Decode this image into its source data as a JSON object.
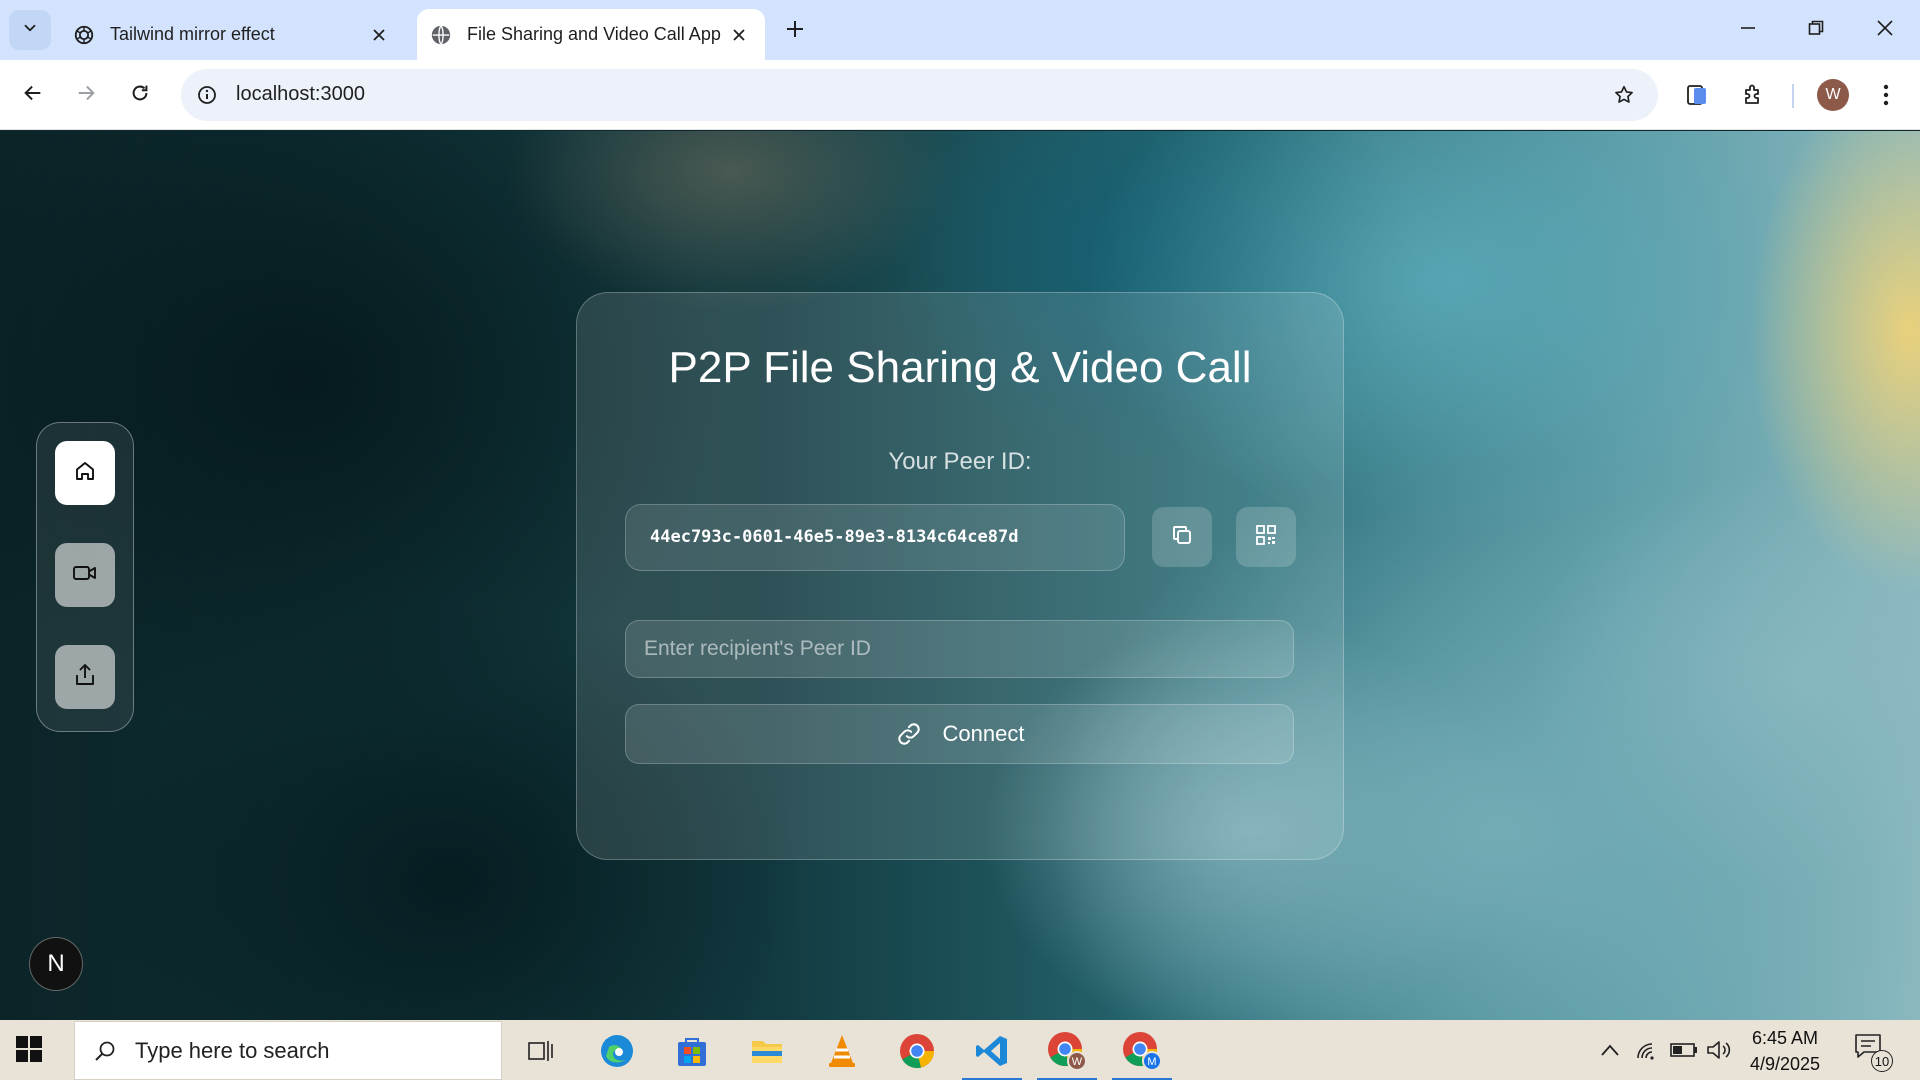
{
  "browser": {
    "tabs": [
      {
        "title": "Tailwind mirror effect",
        "favicon": "openai-logo-icon",
        "active": false
      },
      {
        "title": "File Sharing and Video Call App",
        "favicon": "globe-icon",
        "active": true
      }
    ],
    "address": "localhost:3000",
    "profile_initial": "W"
  },
  "page": {
    "title": "P2P File Sharing & Video Call",
    "peer_label": "Your Peer ID:",
    "peer_id": "44ec793c-0601-46e5-89e3-8134c64ce87d",
    "recipient_placeholder": "Enter recipient's Peer ID",
    "connect_label": "Connect",
    "sidebar": [
      {
        "icon": "home-icon",
        "active": true
      },
      {
        "icon": "video-icon",
        "active": false
      },
      {
        "icon": "share-icon",
        "active": false
      }
    ],
    "framework_badge": "N"
  },
  "taskbar": {
    "search_placeholder": "Type here to search",
    "apps": [
      "task-view",
      "edge",
      "store",
      "file-explorer",
      "vlc",
      "chrome",
      "vscode",
      "chrome-profile-w",
      "chrome-profile-m"
    ],
    "time": "6:45 AM",
    "date": "4/9/2025",
    "notification_count": "10"
  },
  "colors": {
    "titlebar": "#d3e3fd",
    "omnibox": "#edf2fa",
    "taskbar": "#e9e2d6",
    "accent": "#2a78d4"
  }
}
